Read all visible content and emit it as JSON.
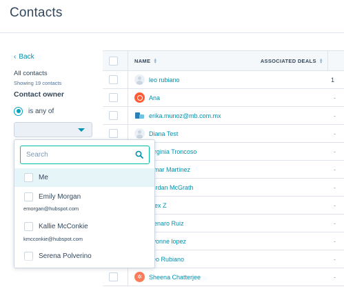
{
  "page": {
    "title": "Contacts"
  },
  "filters": {
    "back_label": "Back",
    "view_name": "All contacts",
    "showing_text": "Showing 19 contacts",
    "owner_heading": "Contact owner",
    "operator_label": "is any of",
    "select_value": ""
  },
  "owner_dropdown": {
    "search_placeholder": "Search",
    "options": [
      {
        "label": "Me",
        "email": ""
      },
      {
        "label": "Emily Morgan",
        "email": "emorgan@hubspot.com"
      },
      {
        "label": "Kallie McConkie",
        "email": "kmcconkie@hubspot.com"
      },
      {
        "label": "Serena Polverino",
        "email": ""
      }
    ]
  },
  "table": {
    "columns": [
      "NAME",
      "ASSOCIATED DEALS"
    ],
    "rows": [
      {
        "name": "leo rubiano",
        "deals": "1",
        "avatar": "default"
      },
      {
        "name": "Ana",
        "deals": "-",
        "avatar": "orange"
      },
      {
        "name": "erika.munoz@mb.com.mx",
        "deals": "-",
        "avatar": "logo"
      },
      {
        "name": "Diana Test",
        "deals": "-",
        "avatar": "default"
      },
      {
        "name": "Virginia Troncoso",
        "deals": "-",
        "avatar": "default"
      },
      {
        "name": "Omar Martínez",
        "deals": "-",
        "avatar": "default"
      },
      {
        "name": "Jordan McGrath",
        "deals": "-",
        "avatar": "default"
      },
      {
        "name": "Alex Z",
        "deals": "-",
        "avatar": "default"
      },
      {
        "name": "Genaro Ruiz",
        "deals": "-",
        "avatar": "default"
      },
      {
        "name": "Yvonne lopez",
        "deals": "-",
        "avatar": "default"
      },
      {
        "name": "Leo Rubiano",
        "deals": "-",
        "avatar": "default"
      },
      {
        "name": "Sheena Chatterjee",
        "deals": "-",
        "avatar": "hubspot"
      }
    ]
  },
  "colors": {
    "accent": "#0091ae",
    "focus": "#00bda5",
    "highlight": "#e5f5f8"
  },
  "icons": {
    "search": "search-icon",
    "back": "chevron-left-icon",
    "caret": "caret-down-icon",
    "sort": "sort-icon"
  }
}
